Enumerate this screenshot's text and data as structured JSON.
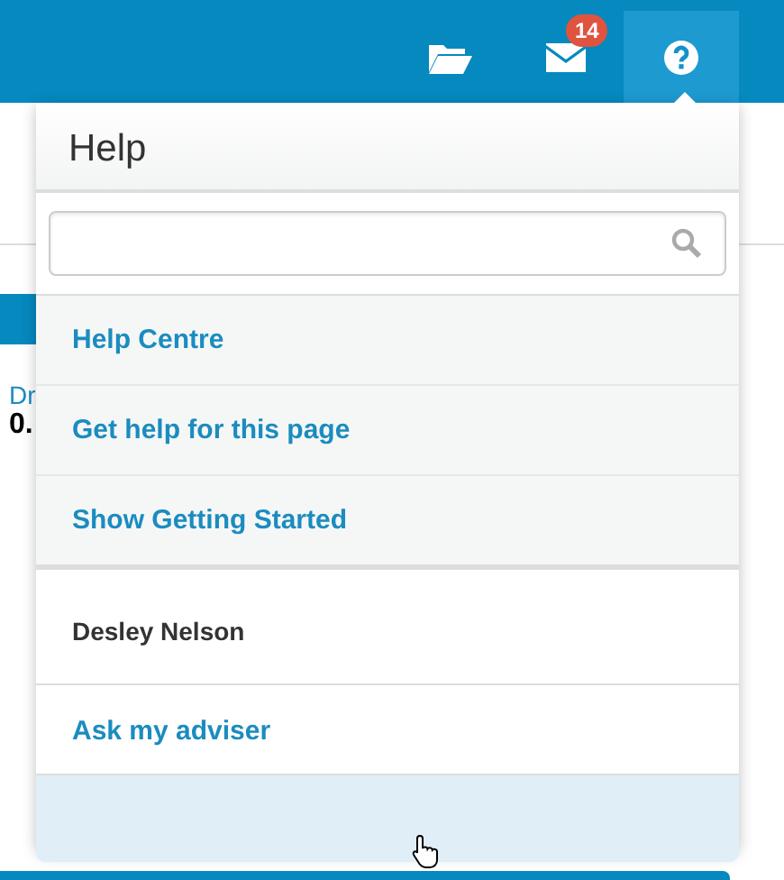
{
  "toolbar": [
    {
      "kind": "folder",
      "selected": false
    },
    {
      "kind": "mail",
      "badge": "14",
      "selected": false
    },
    {
      "kind": "help",
      "selected": true
    }
  ],
  "background": {
    "label": "Dr",
    "value": "0."
  },
  "help_menu": {
    "title": "Help",
    "links": [
      {
        "label": "Help Centre"
      },
      {
        "label": "Get help for this page"
      },
      {
        "label": "Show Getting Started"
      }
    ],
    "adviser": {
      "name": "Desley Nelson",
      "action": "Ask my adviser"
    }
  }
}
